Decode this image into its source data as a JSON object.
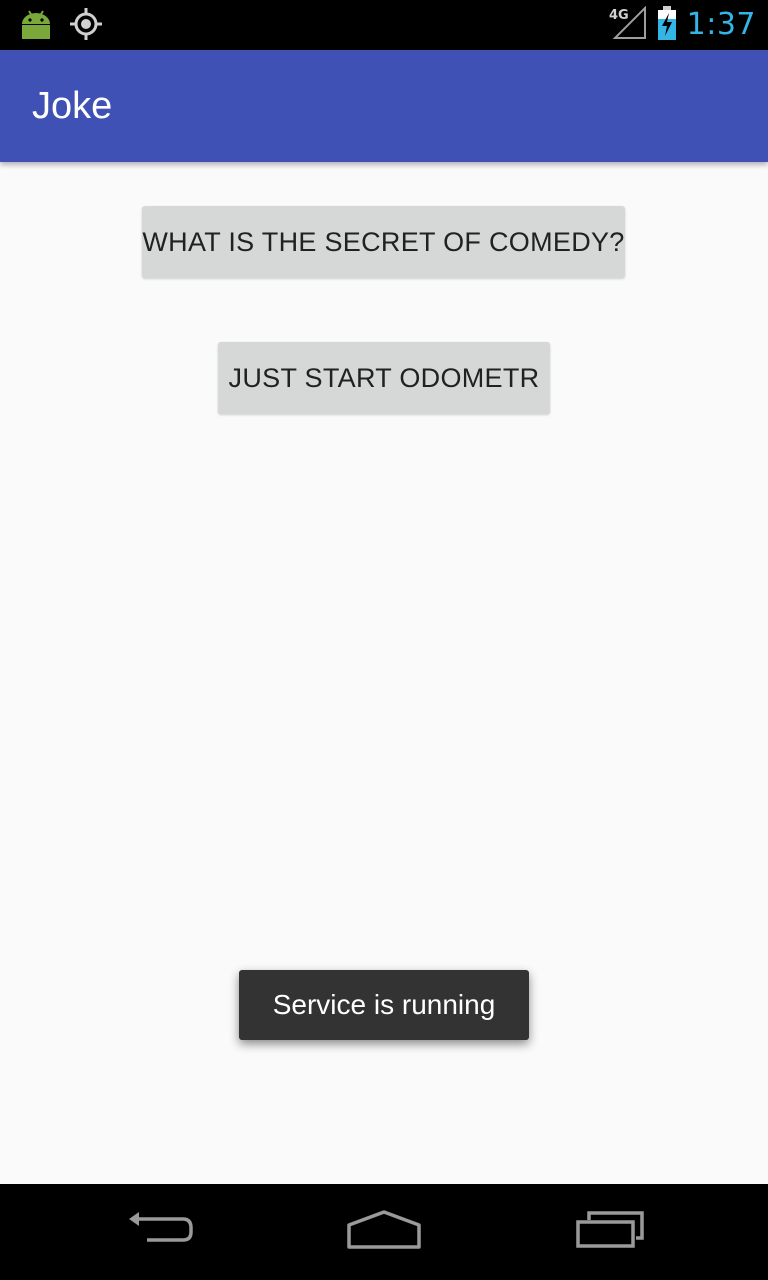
{
  "status_bar": {
    "network_label": "4G",
    "time": "1:37",
    "icons": [
      "android-icon",
      "gps-icon",
      "signal-icon",
      "battery-charging-icon"
    ],
    "clock_color": "#33b5e5"
  },
  "app_bar": {
    "title": "Joke",
    "color": "#3f51b5"
  },
  "main": {
    "joke_button_label": "WHAT IS THE SECRET OF COMEDY?",
    "odometer_button_label": "JUST START ODOMETR"
  },
  "toast": {
    "message": "Service is running"
  },
  "nav_bar": {
    "icons": [
      "back-icon",
      "home-icon",
      "recents-icon"
    ]
  }
}
